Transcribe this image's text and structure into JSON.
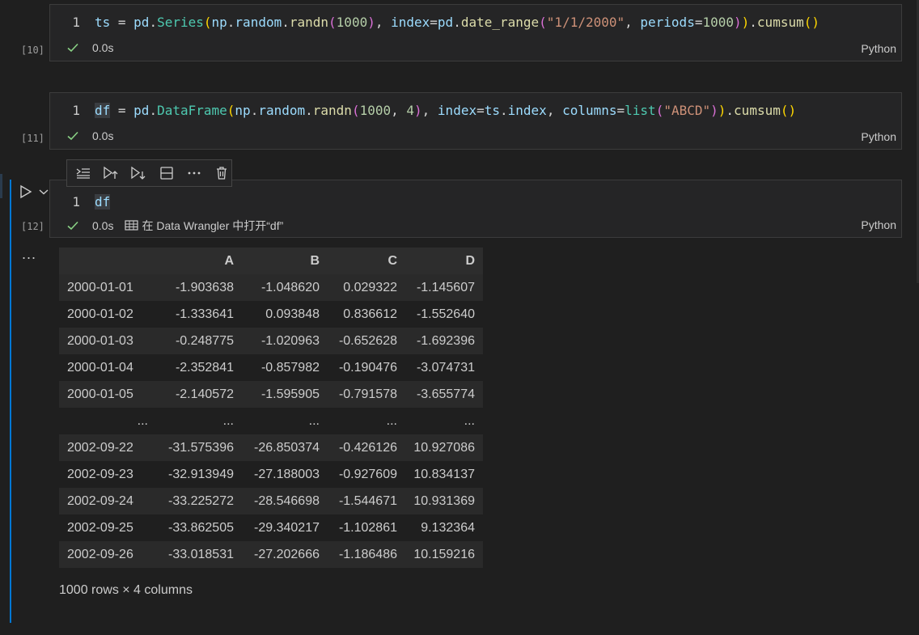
{
  "cells": [
    {
      "exec_count": "[10]",
      "line_number": "1",
      "status_time": "0.0s",
      "language": "Python",
      "code_tokens": [
        {
          "t": "ts",
          "c": "var"
        },
        {
          "t": " = ",
          "c": "op"
        },
        {
          "t": "pd",
          "c": "var"
        },
        {
          "t": ".",
          "c": "op"
        },
        {
          "t": "Series",
          "c": "cls"
        },
        {
          "t": "(",
          "c": "p1"
        },
        {
          "t": "np",
          "c": "var"
        },
        {
          "t": ".",
          "c": "op"
        },
        {
          "t": "random",
          "c": "var"
        },
        {
          "t": ".",
          "c": "op"
        },
        {
          "t": "randn",
          "c": "fn"
        },
        {
          "t": "(",
          "c": "p2"
        },
        {
          "t": "1000",
          "c": "num"
        },
        {
          "t": ")",
          "c": "p2"
        },
        {
          "t": ", ",
          "c": "op"
        },
        {
          "t": "index",
          "c": "var"
        },
        {
          "t": "=",
          "c": "op"
        },
        {
          "t": "pd",
          "c": "var"
        },
        {
          "t": ".",
          "c": "op"
        },
        {
          "t": "date_range",
          "c": "fn"
        },
        {
          "t": "(",
          "c": "p2"
        },
        {
          "t": "\"1/1/2000\"",
          "c": "str"
        },
        {
          "t": ", ",
          "c": "op"
        },
        {
          "t": "periods",
          "c": "var"
        },
        {
          "t": "=",
          "c": "op"
        },
        {
          "t": "1000",
          "c": "num"
        },
        {
          "t": ")",
          "c": "p2"
        },
        {
          "t": ")",
          "c": "p1"
        },
        {
          "t": ".",
          "c": "op"
        },
        {
          "t": "cumsum",
          "c": "fn"
        },
        {
          "t": "()",
          "c": "p1"
        }
      ]
    },
    {
      "exec_count": "[11]",
      "line_number": "1",
      "status_time": "0.0s",
      "language": "Python",
      "code_tokens": [
        {
          "t": "df",
          "c": "var hl"
        },
        {
          "t": " = ",
          "c": "op"
        },
        {
          "t": "pd",
          "c": "var"
        },
        {
          "t": ".",
          "c": "op"
        },
        {
          "t": "DataFrame",
          "c": "cls"
        },
        {
          "t": "(",
          "c": "p1"
        },
        {
          "t": "np",
          "c": "var"
        },
        {
          "t": ".",
          "c": "op"
        },
        {
          "t": "random",
          "c": "var"
        },
        {
          "t": ".",
          "c": "op"
        },
        {
          "t": "randn",
          "c": "fn"
        },
        {
          "t": "(",
          "c": "p2"
        },
        {
          "t": "1000",
          "c": "num"
        },
        {
          "t": ", ",
          "c": "op"
        },
        {
          "t": "4",
          "c": "num"
        },
        {
          "t": ")",
          "c": "p2"
        },
        {
          "t": ", ",
          "c": "op"
        },
        {
          "t": "index",
          "c": "var"
        },
        {
          "t": "=",
          "c": "op"
        },
        {
          "t": "ts",
          "c": "var"
        },
        {
          "t": ".",
          "c": "op"
        },
        {
          "t": "index",
          "c": "var"
        },
        {
          "t": ", ",
          "c": "op"
        },
        {
          "t": "columns",
          "c": "var"
        },
        {
          "t": "=",
          "c": "op"
        },
        {
          "t": "list",
          "c": "cls"
        },
        {
          "t": "(",
          "c": "p2"
        },
        {
          "t": "\"ABCD\"",
          "c": "str"
        },
        {
          "t": ")",
          "c": "p2"
        },
        {
          "t": ")",
          "c": "p1"
        },
        {
          "t": ".",
          "c": "op"
        },
        {
          "t": "cumsum",
          "c": "fn"
        },
        {
          "t": "()",
          "c": "p1"
        }
      ]
    },
    {
      "exec_count": "[12]",
      "line_number": "1",
      "status_time": "0.0s",
      "language": "Python",
      "data_wrangler_link": "在 Data Wrangler 中打开“df”",
      "code_tokens": [
        {
          "t": "df",
          "c": "var hl"
        }
      ]
    }
  ],
  "toolbar": {
    "icons": [
      "execute-above-icon",
      "run-above-icon",
      "run-below-icon",
      "split-cell-icon",
      "more-actions-icon",
      "delete-cell-icon"
    ]
  },
  "output": {
    "ellipsis": "...",
    "columns": [
      "",
      "A",
      "B",
      "C",
      "D"
    ],
    "rows": [
      [
        "2000-01-01",
        "-1.903638",
        "-1.048620",
        "0.029322",
        "-1.145607"
      ],
      [
        "2000-01-02",
        "-1.333641",
        "0.093848",
        "0.836612",
        "-1.552640"
      ],
      [
        "2000-01-03",
        "-0.248775",
        "-1.020963",
        "-0.652628",
        "-1.692396"
      ],
      [
        "2000-01-04",
        "-2.352841",
        "-0.857982",
        "-0.190476",
        "-3.074731"
      ],
      [
        "2000-01-05",
        "-2.140572",
        "-1.595905",
        "-0.791578",
        "-3.655774"
      ],
      [
        "...",
        "...",
        "...",
        "...",
        "..."
      ],
      [
        "2002-09-22",
        "-31.575396",
        "-26.850374",
        "-0.426126",
        "10.927086"
      ],
      [
        "2002-09-23",
        "-32.913949",
        "-27.188003",
        "-0.927609",
        "10.834137"
      ],
      [
        "2002-09-24",
        "-33.225272",
        "-28.546698",
        "-1.544671",
        "10.931369"
      ],
      [
        "2002-09-25",
        "-33.862505",
        "-29.340217",
        "-1.102861",
        "9.132364"
      ],
      [
        "2002-09-26",
        "-33.018531",
        "-27.202666",
        "-1.186486",
        "10.159216"
      ]
    ],
    "shape": "1000 rows × 4 columns"
  },
  "colors": {
    "background": "#1f1f1f",
    "cell_bg": "#252526",
    "accent": "#0078d4",
    "success": "#89d185"
  }
}
